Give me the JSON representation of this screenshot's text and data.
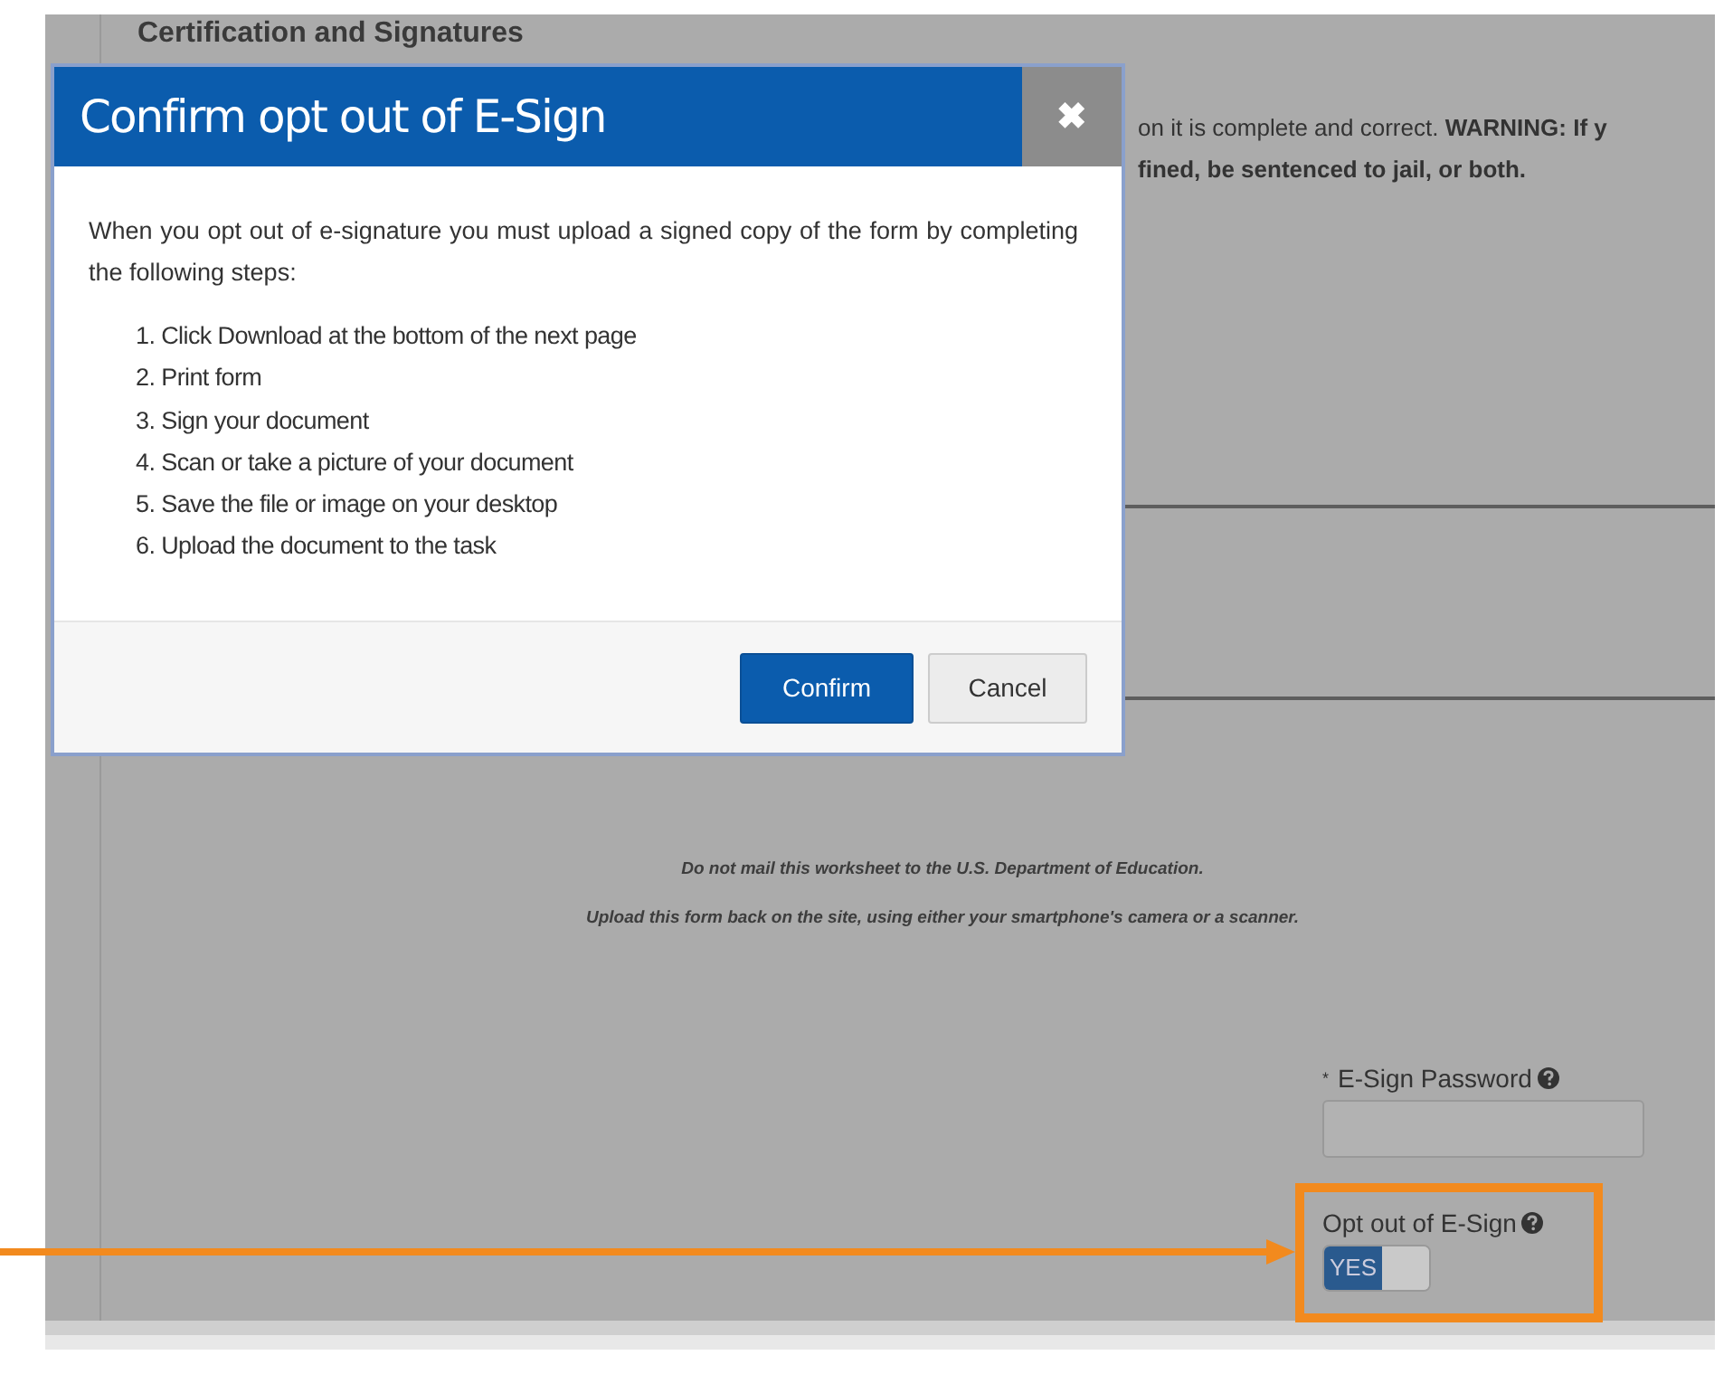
{
  "form": {
    "heading": "Certification and Signatures",
    "warning_lines": [
      "on it is complete and correct. **WARNING: If y**",
      "fined, be sentenced to jail, or both."
    ],
    "notes": [
      "Do not mail this worksheet to the U.S. Department of Education.",
      "Upload this form back on the site, using either your smartphone's camera or a scanner."
    ],
    "password": {
      "label": "E-Sign Password",
      "required_mark": "*"
    },
    "opt_out": {
      "label": "Opt out of E-Sign",
      "on": true,
      "on_text": "YES"
    }
  },
  "modal": {
    "title": "Confirm opt out of E-Sign",
    "close": "✖",
    "intro": "When you opt out of e-signature you must upload a signed copy of the form by completing the following steps:",
    "steps": [
      "1. Click Download at the bottom of the next page",
      "2. Print form",
      "3. Sign your document",
      "4. Scan or take a picture of your document",
      "5. Save the file or image on your desktop",
      "6. Upload the document to the task"
    ],
    "buttons": [
      {
        "label": "Confirm",
        "kind": "primary"
      },
      {
        "label": "Cancel",
        "kind": "secondary"
      }
    ]
  }
}
